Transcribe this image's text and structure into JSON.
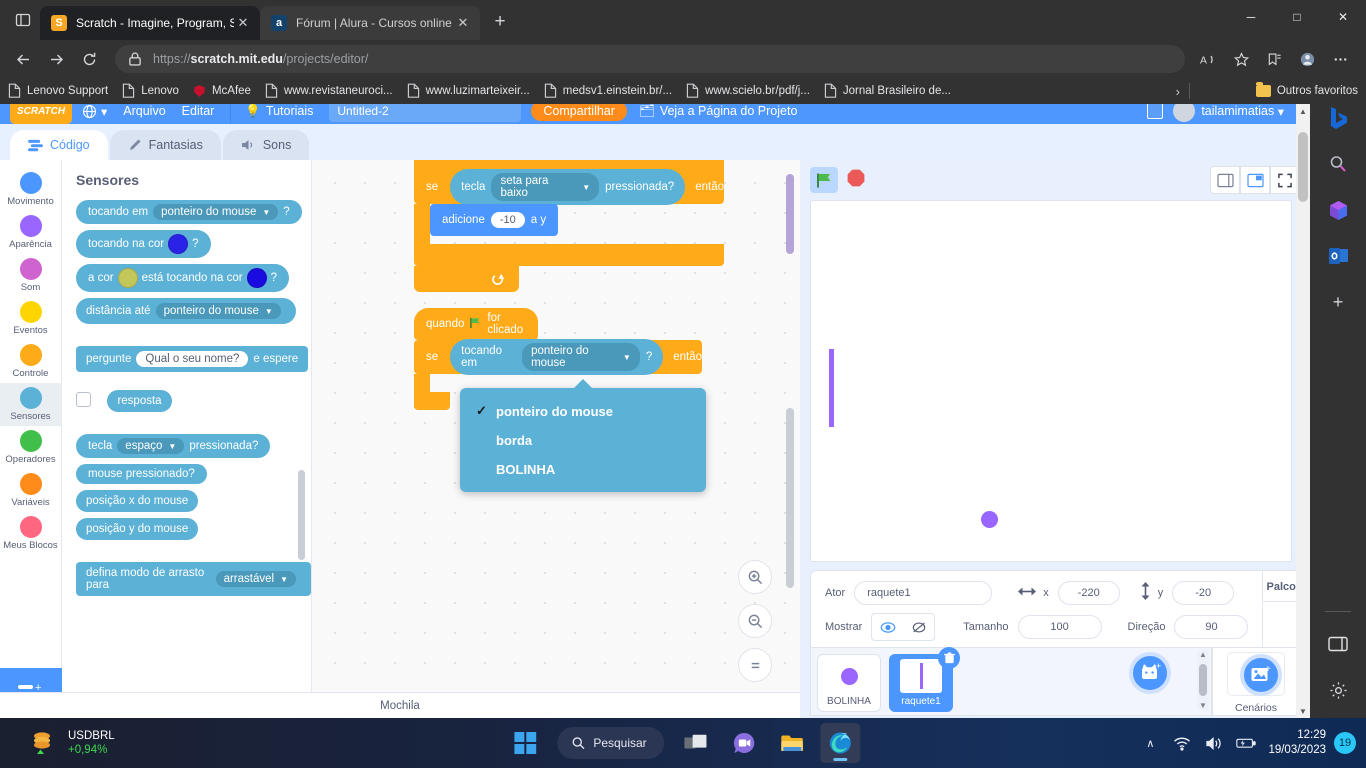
{
  "browser": {
    "tabs": [
      {
        "title": "Scratch - Imagine, Program, Shar",
        "favicon_letter": "S",
        "favicon_color": "#f5a623",
        "active": true,
        "close": "✕"
      },
      {
        "title": "Fórum | Alura - Cursos online de",
        "favicon_letter": "a",
        "favicon_color": "#13426b",
        "active": false,
        "close": "✕"
      }
    ],
    "new_tab_label": "+",
    "window_buttons": {
      "minimize": "─",
      "maximize": "□",
      "close": "✕"
    },
    "nav": {
      "back": "←",
      "forward": "→",
      "reload": "↻"
    },
    "omnibox": {
      "scheme": "https://",
      "host": "scratch.mit.edu",
      "path": "/projects/editor/",
      "lock_icon": "lock-icon"
    },
    "bookmarks": [
      {
        "label": "Lenovo Support",
        "icon": "page-icon"
      },
      {
        "label": "Lenovo",
        "icon": "page-icon"
      },
      {
        "label": "McAfee",
        "icon": "mcafee-icon"
      },
      {
        "label": "www.revistaneuroci...",
        "icon": "page-icon"
      },
      {
        "label": "www.luzimarteixeir...",
        "icon": "page-icon"
      },
      {
        "label": "medsv1.einstein.br/...",
        "icon": "page-icon"
      },
      {
        "label": "www.scielo.br/pdf/j...",
        "icon": "page-icon"
      },
      {
        "label": "Jornal Brasileiro de...",
        "icon": "page-icon"
      }
    ],
    "bookmarks_overflow": "›",
    "other_favorites": "Outros favoritos",
    "sidebar_icons": [
      "bing-icon",
      "search-icon",
      "office-icon",
      "outlook-icon",
      "add-icon",
      "split-screen-icon",
      "settings-icon"
    ]
  },
  "scratch": {
    "menubar": {
      "logo": "SCRATCH",
      "globe": "🌐",
      "items": [
        "Arquivo",
        "Editar"
      ],
      "tutorials": "Tutoriais",
      "project_name": "Untitled-2",
      "share": "Compartilhar",
      "project_page": "Veja a Página do Projeto",
      "username": "tailamimatias"
    },
    "tabs": [
      {
        "label": "Código",
        "icon": "code-icon",
        "active": true
      },
      {
        "label": "Fantasias",
        "icon": "brush-icon",
        "active": false
      },
      {
        "label": "Sons",
        "icon": "sound-icon",
        "active": false
      }
    ],
    "categories": [
      {
        "label": "Movimento",
        "color": "#4c97ff"
      },
      {
        "label": "Aparência",
        "color": "#9966ff"
      },
      {
        "label": "Som",
        "color": "#cf63cf"
      },
      {
        "label": "Eventos",
        "color": "#ffd500"
      },
      {
        "label": "Controle",
        "color": "#ffab19"
      },
      {
        "label": "Sensores",
        "color": "#5cb1d6",
        "selected": true
      },
      {
        "label": "Operadores",
        "color": "#40bf4a"
      },
      {
        "label": "Variáveis",
        "color": "#ff8c1a"
      },
      {
        "label": "Meus Blocos",
        "color": "#ff6680"
      }
    ],
    "add_extension": "add-extension-button",
    "palette": {
      "title": "Sensores",
      "blocks": [
        {
          "id": "touching",
          "parts": [
            "tocando em",
            "ponteiro do mouse",
            "?"
          ]
        },
        {
          "id": "touching-color",
          "parts": [
            "tocando na cor",
            "?"
          ],
          "color": "#2b22e8"
        },
        {
          "id": "color-touching-color",
          "parts": [
            "a cor",
            "está tocando na cor",
            "?"
          ],
          "color1": "#c3c75a",
          "color2": "#1a0ce0"
        },
        {
          "id": "distance-to",
          "parts": [
            "distância até",
            "ponteiro do mouse"
          ]
        },
        {
          "id": "ask-and-wait",
          "parts": [
            "pergunte",
            "Qual o seu nome?",
            "e espere"
          ]
        },
        {
          "id": "answer",
          "parts": [
            "resposta"
          ]
        },
        {
          "id": "key-pressed",
          "parts": [
            "tecla",
            "espaço",
            "pressionada?"
          ]
        },
        {
          "id": "mouse-down",
          "parts": [
            "mouse pressionado?"
          ]
        },
        {
          "id": "mouse-x",
          "parts": [
            "posição x do mouse"
          ]
        },
        {
          "id": "mouse-y",
          "parts": [
            "posição y do mouse"
          ]
        },
        {
          "id": "set-drag-mode",
          "parts": [
            "defina modo de arrasto para",
            "arrastável"
          ]
        }
      ]
    },
    "scripts": {
      "script1": {
        "if_label": "se",
        "then_label": "então",
        "condition_prefix": "tecla",
        "condition_value": "seta para baixo",
        "condition_suffix": "pressionada?",
        "body_prefix": "adicione",
        "body_value": "-10",
        "body_suffix": "a y"
      },
      "script2": {
        "hat_prefix": "quando",
        "hat_suffix": "for clicado",
        "if_label": "se",
        "then_label": "então",
        "condition_prefix": "tocando em",
        "condition_value": "ponteiro do mouse",
        "condition_suffix": "?"
      },
      "dropdown": {
        "items": [
          {
            "label": "ponteiro do mouse",
            "checked": true
          },
          {
            "label": "borda",
            "checked": false
          },
          {
            "label": "BOLINHA",
            "checked": false
          }
        ],
        "check_glyph": "✓"
      }
    },
    "zoom_controls": {
      "zoom_in": "zoom-in-icon",
      "zoom_out": "zoom-out-icon",
      "zoom_reset": "zoom-reset-icon"
    },
    "backpack": "Mochila",
    "stage": {
      "green_flag": "green-flag-icon",
      "stop": "stop-icon",
      "layout_buttons": [
        "small-stage-icon",
        "large-stage-icon",
        "fullscreen-icon"
      ]
    },
    "sprite_info": {
      "name_label": "Ator",
      "name_value": "raquete1",
      "x_label": "x",
      "x_value": "-220",
      "y_label": "y",
      "y_value": "-20",
      "show_label": "Mostrar",
      "size_label": "Tamanho",
      "size_value": "100",
      "direction_label": "Direção",
      "direction_value": "90"
    },
    "sprites": [
      {
        "name": "BOLINHA",
        "selected": false,
        "kind": "ball"
      },
      {
        "name": "raquete1",
        "selected": true,
        "kind": "paddle"
      }
    ],
    "stage_panel": {
      "title": "Palco",
      "backdrops_label": "Cenários",
      "add_backdrop": "add-backdrop-button"
    },
    "add_sprite": "add-sprite-button"
  },
  "taskbar": {
    "widget": {
      "ticker": "USDBRL",
      "change": "+0,94%",
      "arrow": "▲",
      "icon": "coins-icon"
    },
    "start": "windows-start-icon",
    "search_placeholder": "Pesquisar",
    "icons": [
      "task-view-icon",
      "meet-icon",
      "file-explorer-icon",
      "edge-icon"
    ],
    "tray": {
      "chevron": "∧",
      "wifi": "wifi-icon",
      "volume": "volume-icon",
      "battery": "battery-charging-icon"
    },
    "time": "12:29",
    "date": "19/03/2023",
    "notification_count": "19"
  }
}
